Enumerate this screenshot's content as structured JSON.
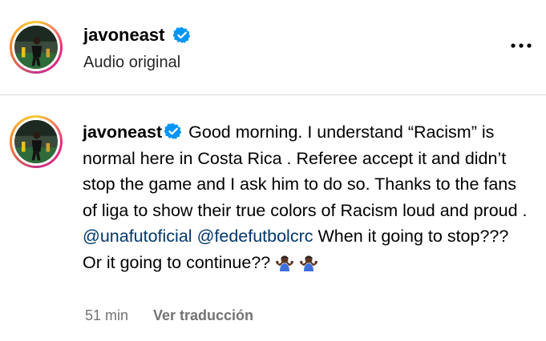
{
  "post": {
    "username": "javoneast",
    "subtitle": "Audio original",
    "more_icon": "more-horizontal-icon"
  },
  "comment": {
    "username": "javoneast",
    "text_1": "Good morning. I understand “Racism” is normal here in Costa Rica . Referee accept it and didn’t stop the game and I ask him to do so. Thanks to the fans of liga to show their true colors of Racism loud and proud .",
    "mention_1": "@unafutoficial",
    "mention_2": "@fedefutbolcrc",
    "text_2": "When it going to stop??? Or it going to continue??",
    "emoji": "person-shrugging-emoji",
    "time": "51 min",
    "translate_label": "Ver traducción"
  },
  "colors": {
    "verified_blue": "#0095f6",
    "mention_blue": "#00376b",
    "meta_gray": "#737373"
  }
}
